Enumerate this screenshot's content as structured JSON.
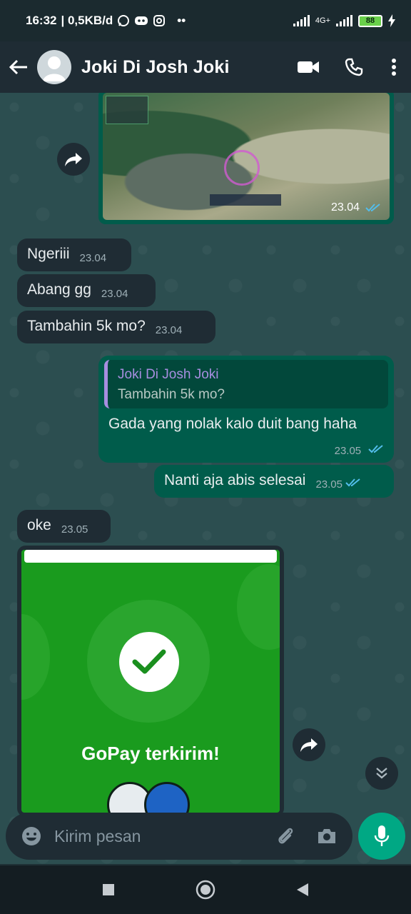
{
  "status_bar": {
    "time": "16:32",
    "net_speed": "| 0,5KB/d",
    "net_type": "4G+",
    "battery": "88"
  },
  "header": {
    "contact_name": "Joki Di Josh Joki",
    "icons": [
      "back-arrow-icon",
      "video-call-icon",
      "phone-icon",
      "more-vert-icon"
    ]
  },
  "messages": [
    {
      "type": "image",
      "direction": "out",
      "time": "23.04",
      "status": "read"
    },
    {
      "type": "text",
      "direction": "in",
      "text": "Ngeriii",
      "time": "23.04"
    },
    {
      "type": "text",
      "direction": "in",
      "text": "Abang gg",
      "time": "23.04"
    },
    {
      "type": "text",
      "direction": "in",
      "text": "Tambahin 5k mo?",
      "time": "23.04"
    },
    {
      "type": "reply",
      "direction": "out",
      "quoted_author": "Joki Di Josh Joki",
      "quoted_text": "Tambahin 5k mo?",
      "text": "Gada yang nolak kalo duit bang haha",
      "time": "23.05",
      "status": "read"
    },
    {
      "type": "text",
      "direction": "out",
      "text": "Nanti aja abis selesai",
      "time": "23.05",
      "status": "read"
    },
    {
      "type": "text",
      "direction": "in",
      "text": "oke",
      "time": "23.05"
    },
    {
      "type": "image",
      "direction": "in",
      "caption_in_image": "GoPay terkirim!"
    }
  ],
  "input": {
    "placeholder": "Kirim pesan"
  },
  "colors": {
    "header_bg": "#1f2c34",
    "incoming_bubble": "#1f2c34",
    "outgoing_bubble": "#005c4b",
    "accent": "#00a884",
    "read_ticks": "#53bdeb",
    "gopay_green": "#1a9b1e"
  }
}
